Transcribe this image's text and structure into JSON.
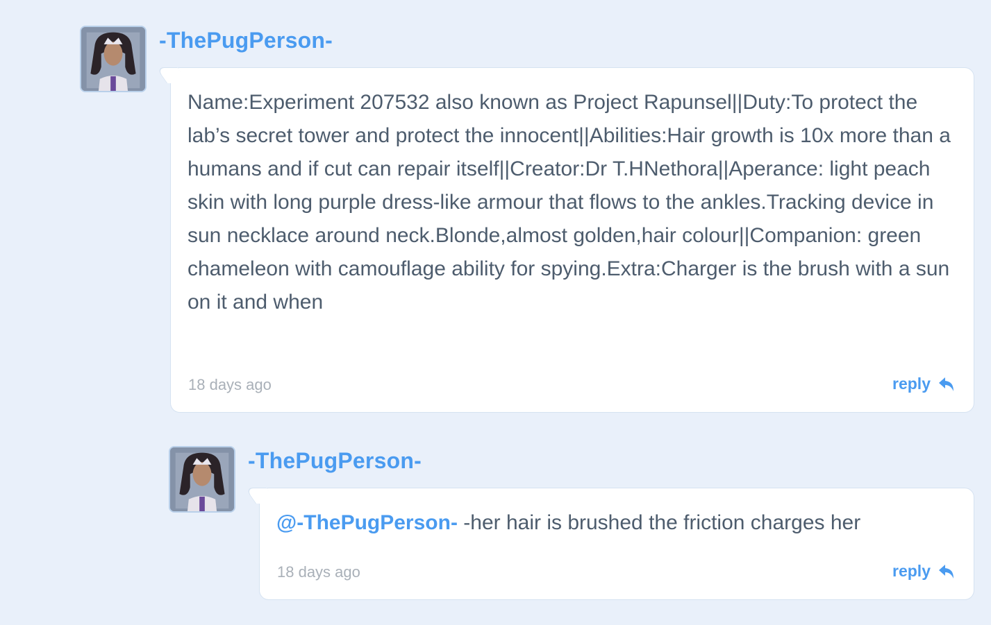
{
  "comments": [
    {
      "username": "-ThePugPerson-",
      "avatar_icon": "user-avatar-icon",
      "body": "Name:Experiment 207532 also known as Project Rapunsel||Duty:To protect the lab’s secret tower and protect the innocent||Abilities:Hair growth is 10x more than a humans and if cut can repair itself||Creator:Dr T.HNethora||Aperance: light peach skin with long purple dress-like armour that flows to the ankles.Tracking device in sun necklace around neck.Blonde,almost golden,hair colour||Companion: green chameleon with camouflage ability for spying.Extra:Charger is the brush with a sun on it and when",
      "timestamp": "18 days ago",
      "reply_label": "reply",
      "reply_icon": "reply-arrow-icon"
    },
    {
      "username": "-ThePugPerson-",
      "avatar_icon": "user-avatar-icon",
      "mention": "@-ThePugPerson-",
      "body": " -her hair is brushed the friction charges her",
      "timestamp": "18 days ago",
      "reply_label": "reply",
      "reply_icon": "reply-arrow-icon"
    }
  ],
  "colors": {
    "background": "#e9f0fa",
    "accent": "#4a9bf0",
    "text": "#4d5c6d",
    "muted": "#a9b0b8"
  }
}
